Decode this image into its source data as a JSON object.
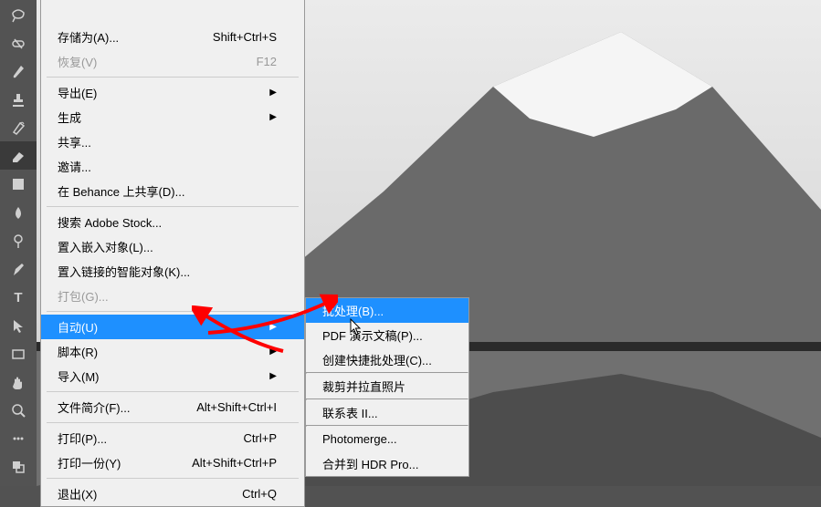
{
  "toolbar": {
    "tools": [
      {
        "name": "lasso-icon",
        "shape": "lasso"
      },
      {
        "name": "healing-icon",
        "shape": "band"
      },
      {
        "name": "brush-icon",
        "shape": "brush"
      },
      {
        "name": "stamp-icon",
        "shape": "stamp"
      },
      {
        "name": "history-icon",
        "shape": "history"
      },
      {
        "name": "eraser-icon",
        "shape": "eraser",
        "active": true
      },
      {
        "name": "gradient-icon",
        "shape": "square"
      },
      {
        "name": "blur-icon",
        "shape": "drop"
      },
      {
        "name": "dodge-icon",
        "shape": "pin"
      },
      {
        "name": "pen-icon",
        "shape": "pen"
      },
      {
        "name": "type-icon",
        "shape": "T"
      },
      {
        "name": "path-icon",
        "shape": "pointer"
      },
      {
        "name": "rect-icon",
        "shape": "rect"
      },
      {
        "name": "hand-icon",
        "shape": "hand"
      },
      {
        "name": "zoom-icon",
        "shape": "zoom"
      },
      {
        "name": "ellipsis-icon",
        "shape": "dots"
      },
      {
        "name": "swatch-icon",
        "shape": "swatch"
      }
    ]
  },
  "menu": [
    {
      "label": "",
      "shortcut": "",
      "disabled": true
    },
    {
      "label": "存储为(A)...",
      "shortcut": "Shift+Ctrl+S"
    },
    {
      "label": "恢复(V)",
      "shortcut": "F12",
      "disabled": true
    },
    {
      "sep": true
    },
    {
      "label": "导出(E)",
      "arrow": true
    },
    {
      "label": "生成",
      "arrow": true
    },
    {
      "label": "共享...",
      "shortcut": ""
    },
    {
      "label": "邀请...",
      "shortcut": ""
    },
    {
      "label": "在 Behance 上共享(D)...",
      "shortcut": ""
    },
    {
      "sep": true
    },
    {
      "label": "搜索 Adobe Stock...",
      "shortcut": ""
    },
    {
      "label": "置入嵌入对象(L)...",
      "shortcut": ""
    },
    {
      "label": "置入链接的智能对象(K)...",
      "shortcut": ""
    },
    {
      "label": "打包(G)...",
      "shortcut": "",
      "disabled": true
    },
    {
      "sep": true
    },
    {
      "label": "自动(U)",
      "arrow": true,
      "hl": true
    },
    {
      "label": "脚本(R)",
      "arrow": true
    },
    {
      "label": "导入(M)",
      "arrow": true
    },
    {
      "sep": true
    },
    {
      "label": "文件简介(F)...",
      "shortcut": "Alt+Shift+Ctrl+I"
    },
    {
      "sep": true
    },
    {
      "label": "打印(P)...",
      "shortcut": "Ctrl+P"
    },
    {
      "label": "打印一份(Y)",
      "shortcut": "Alt+Shift+Ctrl+P"
    },
    {
      "sep": true
    },
    {
      "label": "退出(X)",
      "shortcut": "Ctrl+Q"
    }
  ],
  "submenu": [
    {
      "label": "批处理(B)...",
      "hl": true
    },
    {
      "label": "PDF 演示文稿(P)..."
    },
    {
      "label": "创建快捷批处理(C)..."
    },
    {
      "sep": true
    },
    {
      "label": "裁剪并拉直照片"
    },
    {
      "sep": true
    },
    {
      "label": "联系表 II..."
    },
    {
      "sep": true
    },
    {
      "label": "Photomerge..."
    },
    {
      "label": "合并到 HDR Pro..."
    }
  ]
}
